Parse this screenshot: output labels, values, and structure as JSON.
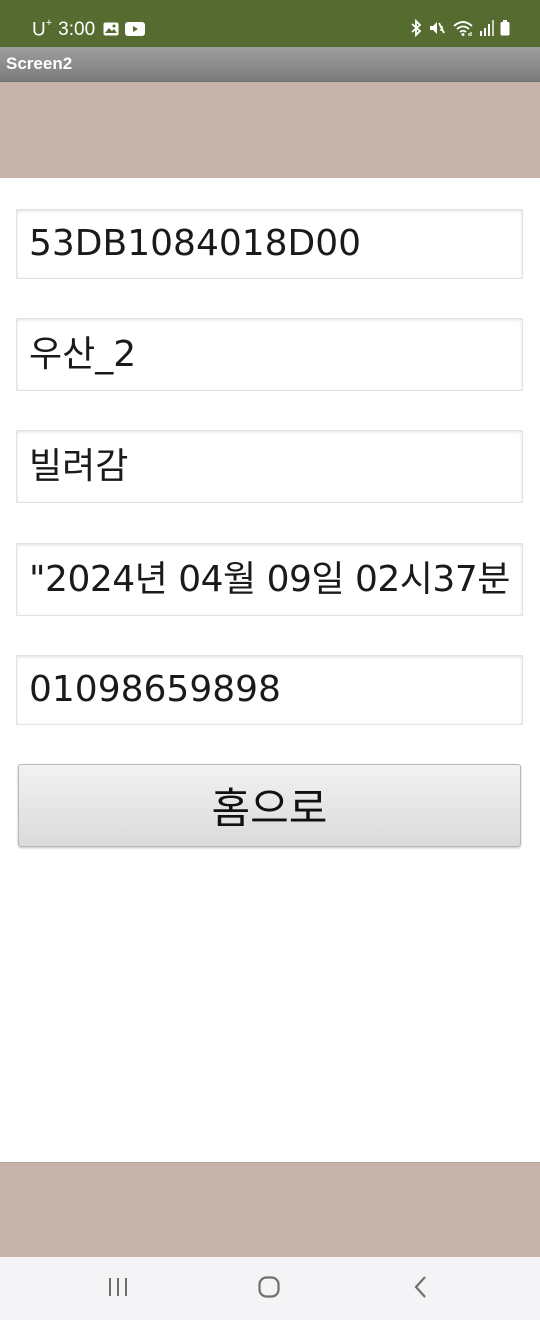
{
  "status_bar": {
    "carrier": "U",
    "carrier_sup": "+",
    "time": "3:00",
    "icons": [
      "gallery-icon",
      "youtube-icon",
      "bluetooth-icon",
      "mute-icon",
      "wifi-icon",
      "signal-icon",
      "battery-icon"
    ]
  },
  "app": {
    "title": "Screen2"
  },
  "form": {
    "field_1": "53DB1084018D00",
    "field_2": "우산_2",
    "field_3": "빌려감",
    "field_4": "\"2024년 04월 09일 02시37분",
    "field_5": "01098659898",
    "home_button": "홈으로"
  },
  "colors": {
    "status_bar": "#556b2f",
    "band": "#c6b4aa",
    "title_bar": "#8c8c8c"
  },
  "nav_bar": {
    "icons": [
      "recents-icon",
      "home-icon",
      "back-icon"
    ]
  }
}
